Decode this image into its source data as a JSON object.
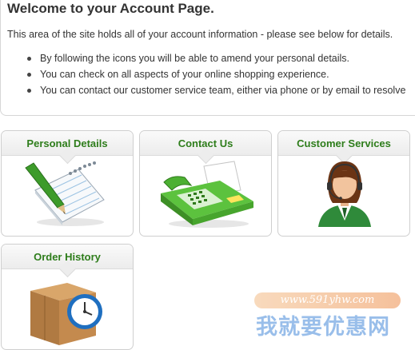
{
  "page": {
    "title": "Welcome to your Account Page.",
    "intro": "This area of the site holds all of your account information - please see below for details.",
    "bullets": [
      "By following the icons you will be able to amend your personal details.",
      "You can check on all aspects of your online shopping experience.",
      "You can contact our customer service team, either via phone or by email to resolve"
    ]
  },
  "cards": [
    {
      "label": "Personal Details",
      "icon": "notepad-pen-icon"
    },
    {
      "label": "Contact Us",
      "icon": "fax-machine-icon"
    },
    {
      "label": "Customer Services",
      "icon": "support-agent-headset-icon"
    },
    {
      "label": "Order History",
      "icon": "box-clock-icon"
    }
  ],
  "watermark": {
    "url": "www.591yhw.com",
    "text": "我就要优惠网"
  },
  "colors": {
    "card_label": "#2e7d1b",
    "border": "#cfcfcf",
    "text": "#333333"
  }
}
